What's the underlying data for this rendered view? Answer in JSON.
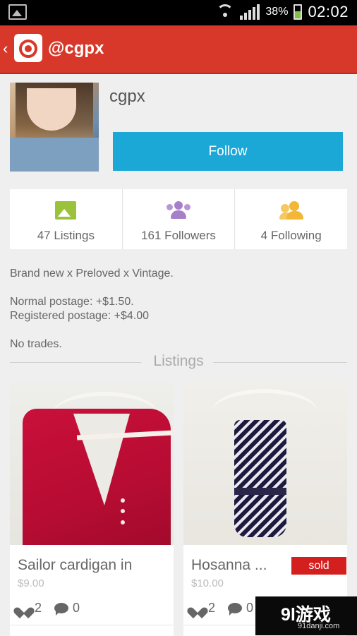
{
  "status_bar": {
    "battery_percent": "38%",
    "time": "02:02"
  },
  "app_bar": {
    "title": "@cgpx"
  },
  "profile": {
    "username": "cgpx",
    "follow_label": "Follow"
  },
  "stats": {
    "listings": "47 Listings",
    "followers": "161 Followers",
    "following": "4 Following"
  },
  "bio": {
    "line1": "Brand new x Preloved x Vintage.",
    "line2": "Normal postage: +$1.50.",
    "line3": "Registered postage: +$4.00",
    "line4": "No trades."
  },
  "listings_header": "Listings",
  "listings": [
    {
      "title": "Sailor cardigan in",
      "price": "$9.00",
      "likes": "2",
      "comments": "0"
    },
    {
      "title": "Hosanna ...",
      "price": "$10.00",
      "likes": "2",
      "comments": "0",
      "badge": "sold"
    }
  ],
  "watermark": {
    "logo": "9l游戏",
    "url": "91danji.com"
  },
  "colors": {
    "app_bar": "#d8382a",
    "follow_button": "#1ba8d6",
    "sold_badge": "#d41f1f",
    "listings_icon": "#9ac33b",
    "followers_icon": "#a67fc9",
    "following_icon": "#f2b736"
  }
}
